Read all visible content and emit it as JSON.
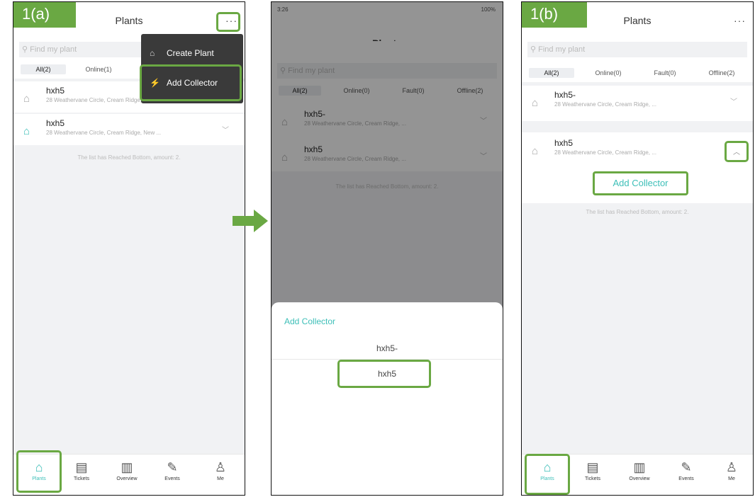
{
  "tags": {
    "p1": "1(a)",
    "p3": "1(b)"
  },
  "app": {
    "title": "Plants",
    "more": "···",
    "search_placeholder": "Find my plant",
    "list_bottom": "The list has Reached Bottom, amount: 2.",
    "status_time": "3:26",
    "status_right": "100%"
  },
  "tabs_p1": [
    "All(2)",
    "Online(1)"
  ],
  "tabs_full": [
    "All(2)",
    "Online(0)",
    "Fault(0)",
    "Offline(2)"
  ],
  "tabs_p2": [
    "All(2)",
    "Online(0)",
    "Fault(0)",
    "Offline(2)"
  ],
  "plants": [
    {
      "name": "hxh5",
      "address": "28 Weathervane Circle, Cream Ridge, New ..."
    },
    {
      "name": "hxh5",
      "address": "28 Weathervane Circle, Cream Ridge, New ..."
    }
  ],
  "plants_p2": [
    {
      "name": "hxh5-",
      "address": "28 Weathervane Circle, Cream Ridge, ..."
    },
    {
      "name": "hxh5",
      "address": "28 Weathervane Circle, Cream Ridge, ..."
    }
  ],
  "menu": {
    "create": "Create Plant",
    "add": "Add Collector"
  },
  "sheet": {
    "title": "Add Collector",
    "options": [
      "hxh5-",
      "hxh5"
    ]
  },
  "expand": {
    "add_collector": "Add Collector"
  },
  "tabbar": [
    "Plants",
    "Tickets",
    "Overview",
    "Events",
    "Me"
  ],
  "colors": {
    "accent": "#3dbfb8",
    "highlight": "#6aa843"
  }
}
